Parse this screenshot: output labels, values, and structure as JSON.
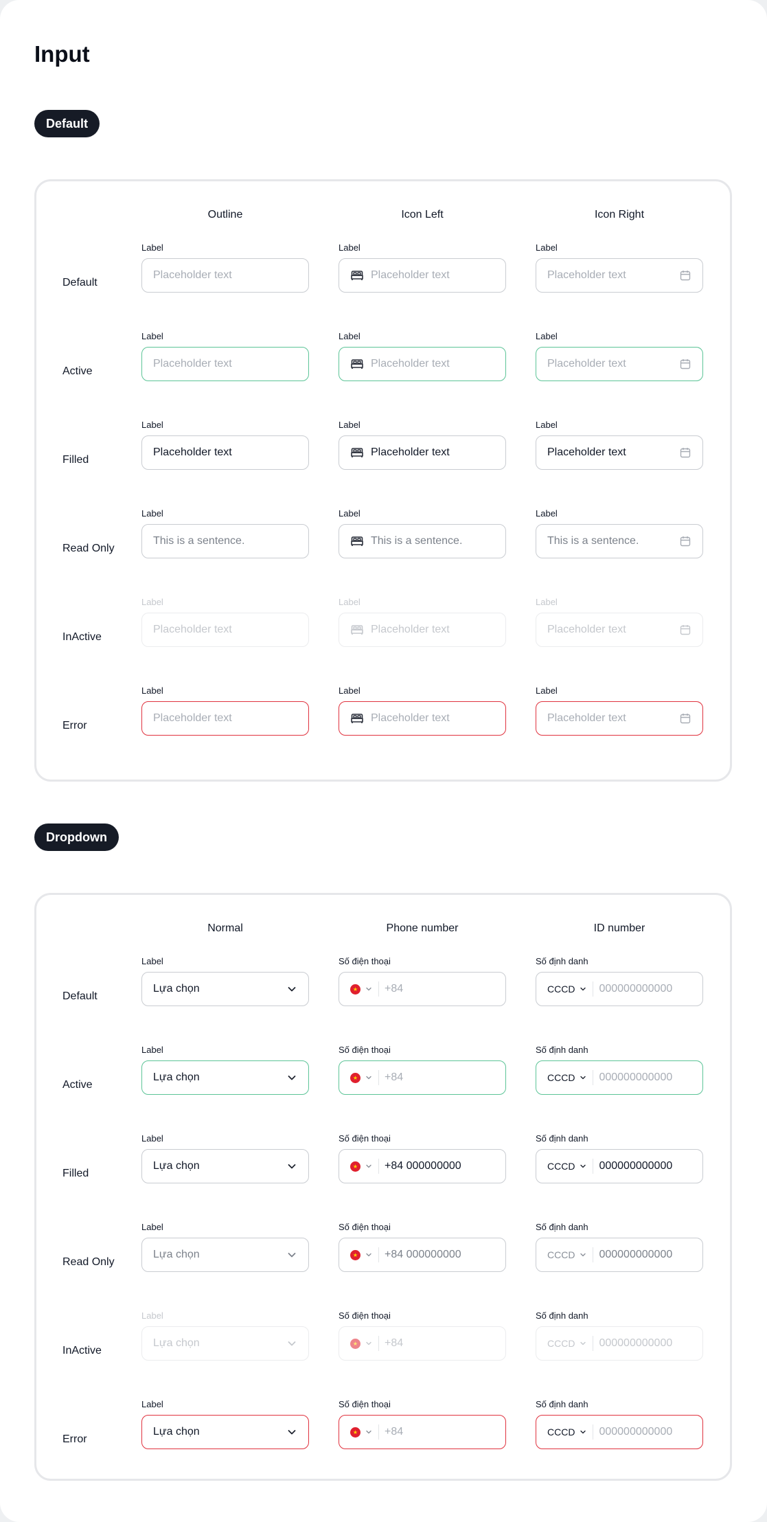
{
  "page_title": "Input",
  "sections": {
    "input": {
      "pill_label": "Default",
      "columns": [
        "Outline",
        "Icon Left",
        "Icon Right"
      ],
      "rows": [
        "Default",
        "Active",
        "Filled",
        "Read Only",
        "InActive",
        "Error"
      ],
      "field_label": "Label",
      "placeholder": "Placeholder text",
      "filled_value": "Placeholder text",
      "readonly_value": "This is a sentence.",
      "icons": {
        "left": "bed-icon",
        "right": "calendar-icon"
      }
    },
    "dropdown": {
      "pill_label": "Dropdown",
      "columns": [
        "Normal",
        "Phone number",
        "ID number"
      ],
      "rows": [
        "Default",
        "Active",
        "Filled",
        "Read Only",
        "InActive",
        "Error"
      ],
      "normal_label": "Label",
      "normal_value": "Lựa chọn",
      "phone_label": "Số điện thoại",
      "phone_placeholder": "+84",
      "phone_filled": "+84 000000000",
      "id_label": "Số định danh",
      "id_type": "CCCD",
      "id_value": "000000000000",
      "icons": {
        "chevron": "chevron-down-icon",
        "flag": "vietnam-flag-icon"
      }
    }
  },
  "colors": {
    "active_border": "#5cc497",
    "error_border": "#e0323e",
    "default_border": "#c9ccd1",
    "pill_bg": "#161b26"
  }
}
